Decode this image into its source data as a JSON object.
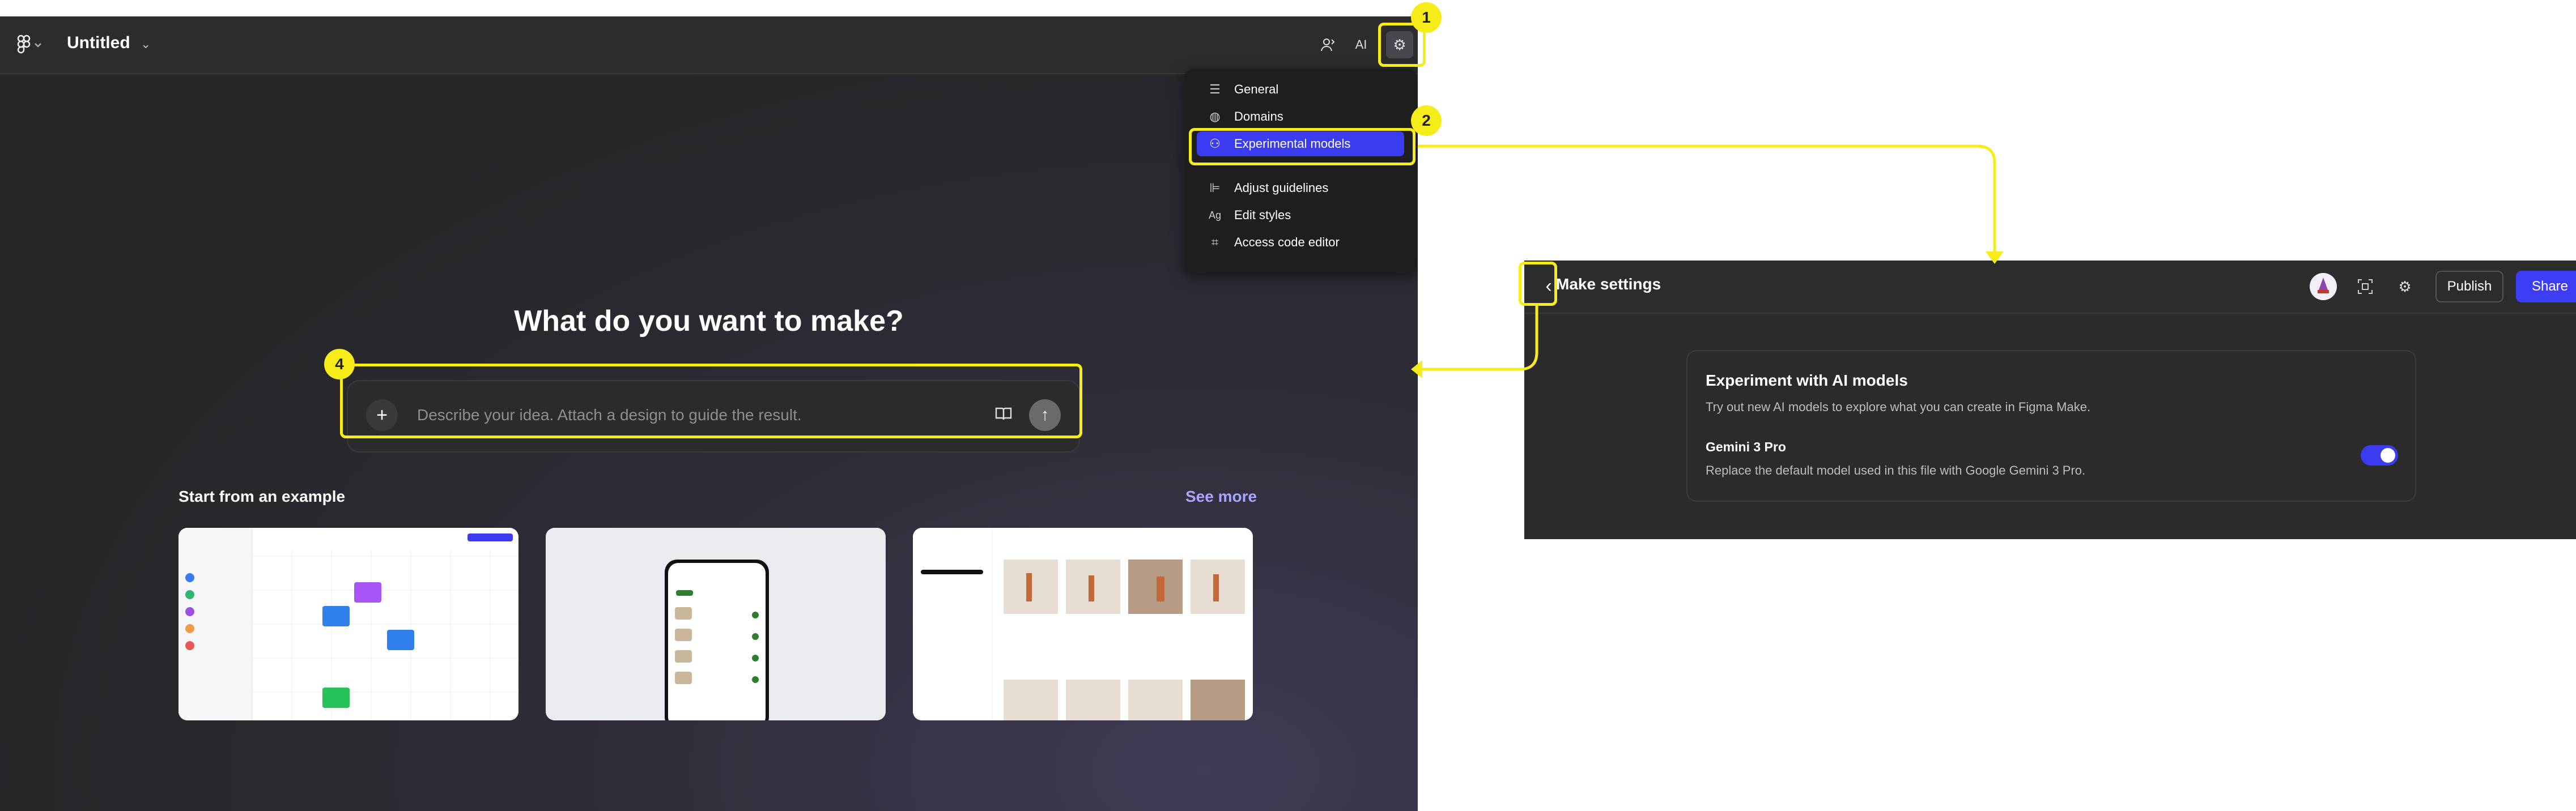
{
  "left_app": {
    "title": "Untitled",
    "ai_label": "AI",
    "menu_items": [
      {
        "label": "General",
        "icon": "list-icon"
      },
      {
        "label": "Domains",
        "icon": "globe-icon"
      },
      {
        "label": "Experimental models",
        "icon": "experiment-icon"
      },
      {
        "label": "Adjust guidelines",
        "icon": "guidelines-icon"
      },
      {
        "label": "Edit styles",
        "icon": "text-style-icon"
      },
      {
        "label": "Access code editor",
        "icon": "code-icon"
      }
    ],
    "menu_icon_glyphs": [
      "☰",
      "◍",
      "⚇",
      "⊫",
      "Ag",
      "⌗"
    ],
    "hero_title": "What do you want to make?",
    "prompt_placeholder": "Describe your idea. Attach a design to guide the result.",
    "examples_title": "Start from an example",
    "see_more": "See more"
  },
  "right_app": {
    "title": "Make settings",
    "publish": "Publish",
    "share": "Share",
    "experiment": {
      "heading": "Experiment with AI models",
      "description": "Try out new AI models to explore what you can create in Figma Make.",
      "model_name": "Gemini 3 Pro",
      "model_description": "Replace the default model used in this file with Google Gemini 3 Pro.",
      "enabled": true
    }
  },
  "annotations": {
    "badge_1": "1",
    "badge_2": "2",
    "badge_4": "4",
    "color": "#f5ec1a"
  },
  "colors": {
    "accent": "#3b3bf2",
    "background": "#2b2b2b"
  }
}
